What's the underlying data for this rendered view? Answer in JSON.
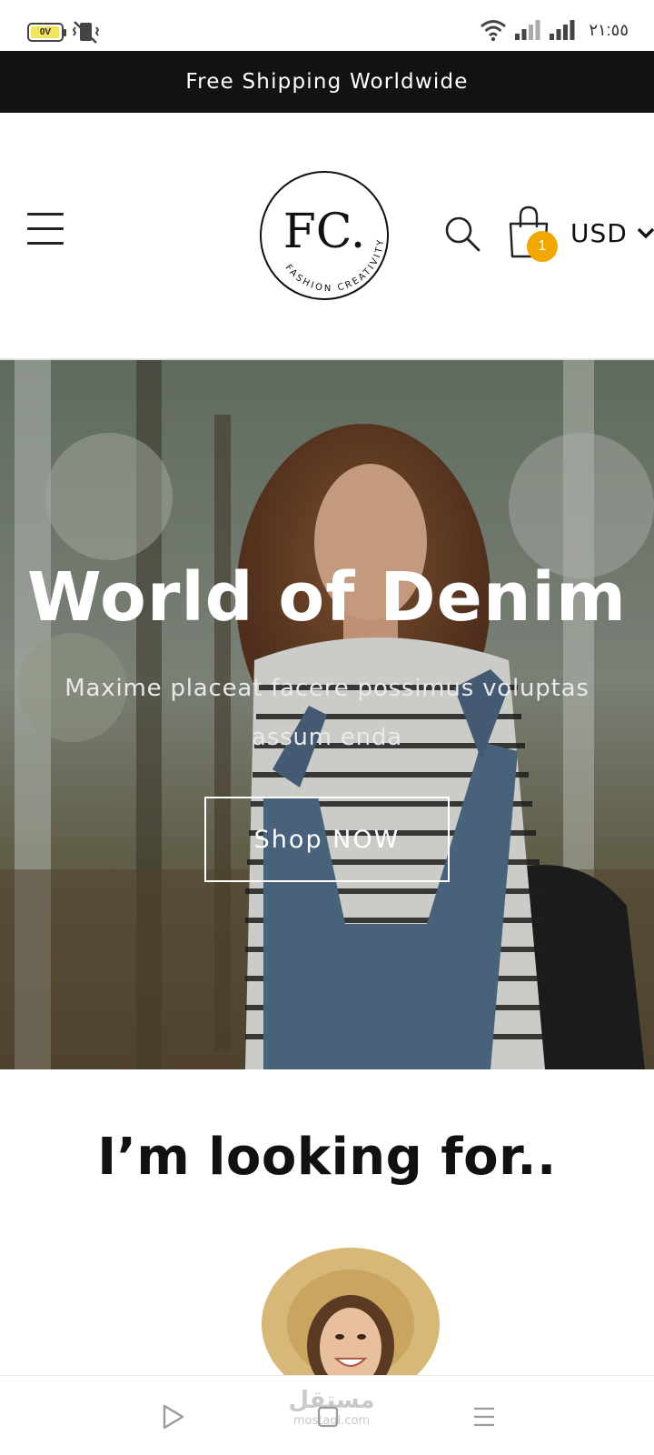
{
  "status_bar": {
    "battery_label": "0V",
    "time": "٢١:٥٥",
    "icons": [
      "battery-icon",
      "vibrate-icon",
      "wifi-icon",
      "signal-icon",
      "signal-icon"
    ]
  },
  "announcement": {
    "text": "Free Shipping Worldwide"
  },
  "header": {
    "logo_text": "FC.",
    "logo_tagline": "FASHION CREATIVITY",
    "cart_count": "1",
    "currency": "USD",
    "accent_color": "#f0a800"
  },
  "hero": {
    "title": "World of Denim",
    "subtitle": "Maxime placeat facere possimus voluptas assum enda",
    "button_label": "Shop NOW"
  },
  "categories": {
    "title": "I’m looking for.."
  },
  "nav_bar": {
    "watermark_main": "مستقل",
    "watermark_sub": "mostaql.com"
  }
}
